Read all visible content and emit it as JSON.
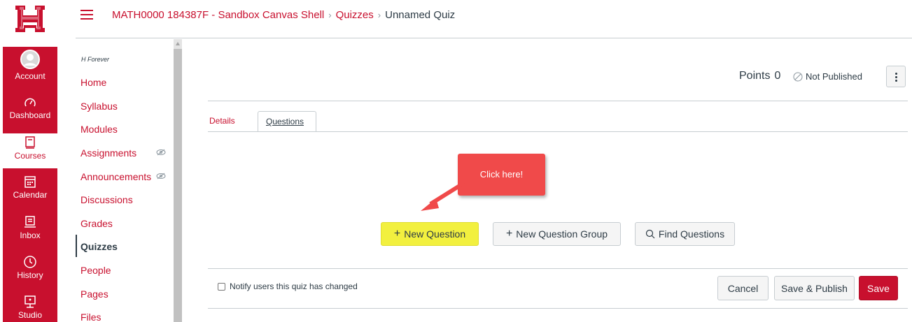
{
  "global_nav": {
    "items": [
      {
        "label": "Account",
        "icon": "account-icon"
      },
      {
        "label": "Dashboard",
        "icon": "dashboard-icon"
      },
      {
        "label": "Courses",
        "icon": "courses-icon"
      },
      {
        "label": "Calendar",
        "icon": "calendar-icon"
      },
      {
        "label": "Inbox",
        "icon": "inbox-icon"
      },
      {
        "label": "History",
        "icon": "history-icon"
      },
      {
        "label": "Studio",
        "icon": "studio-icon"
      }
    ],
    "active": "Courses",
    "brand_color": "#c8102e"
  },
  "breadcrumb": {
    "course": "MATH0000 184387F - Sandbox Canvas Shell",
    "section": "Quizzes",
    "current": "Unnamed Quiz"
  },
  "course_nav": {
    "subtitle": "H Forever",
    "items": [
      {
        "label": "Home"
      },
      {
        "label": "Syllabus"
      },
      {
        "label": "Modules"
      },
      {
        "label": "Assignments",
        "hidden_icon": true
      },
      {
        "label": "Announcements",
        "hidden_icon": true
      },
      {
        "label": "Discussions"
      },
      {
        "label": "Grades"
      },
      {
        "label": "Quizzes",
        "active": true
      },
      {
        "label": "People"
      },
      {
        "label": "Pages"
      },
      {
        "label": "Files"
      }
    ]
  },
  "quiz_header": {
    "points_label": "Points",
    "points_value": "0",
    "status": "Not Published"
  },
  "tabs": [
    {
      "label": "Details"
    },
    {
      "label": "Questions",
      "active": true
    }
  ],
  "callout": {
    "text": "Click here!",
    "color": "#f04a4a"
  },
  "question_actions": {
    "new_question": "New Question",
    "new_question_group": "New Question Group",
    "find_questions": "Find Questions",
    "highlight_color": "#f2f03f"
  },
  "footer": {
    "notify_label": "Notify users this quiz has changed",
    "notify_checked": false,
    "cancel": "Cancel",
    "save_publish": "Save & Publish",
    "save": "Save"
  }
}
